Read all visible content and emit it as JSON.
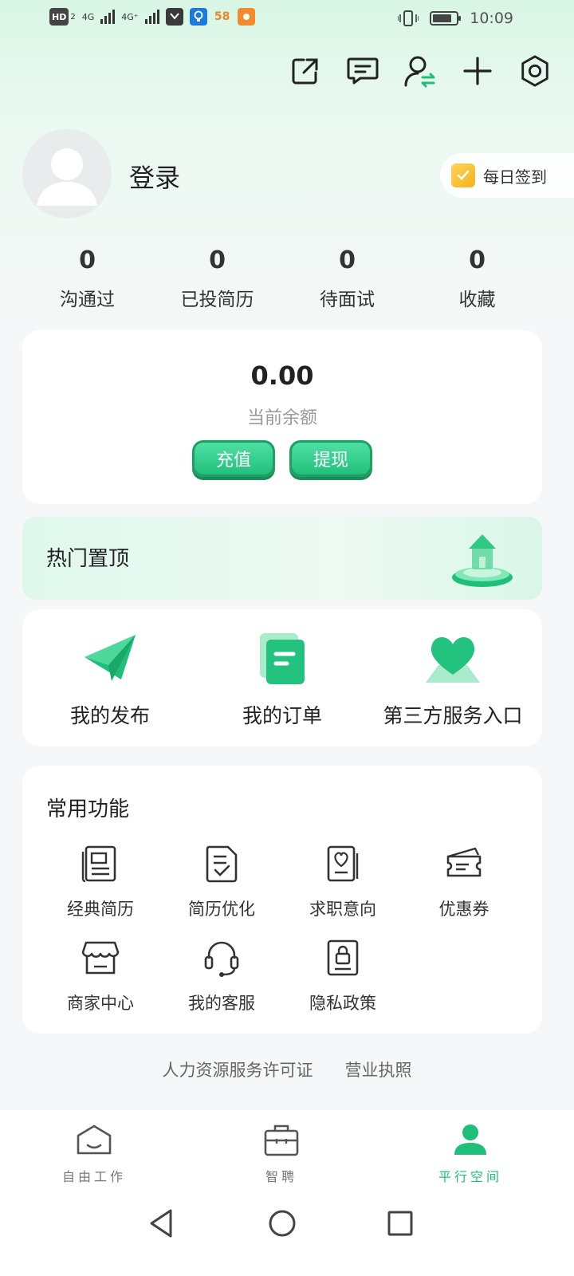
{
  "status_bar": {
    "network_hd": "HD",
    "network_hd_sub": "2",
    "signal_1": "4G",
    "signal_2": "4G⁺",
    "app_58": "58",
    "time": "10:09",
    "battery_level": 0.8
  },
  "profile": {
    "login_label": "登录",
    "checkin_label": "每日签到"
  },
  "stats": [
    {
      "value": "0",
      "label": "沟通过"
    },
    {
      "value": "0",
      "label": "已投简历"
    },
    {
      "value": "0",
      "label": "待面试"
    },
    {
      "value": "0",
      "label": "收藏"
    }
  ],
  "balance": {
    "amount": "0.00",
    "label": "当前余额",
    "recharge_label": "充值",
    "withdraw_label": "提现"
  },
  "hot": {
    "title": "热门置顶"
  },
  "quick": [
    {
      "label": "我的发布",
      "icon": "paper-plane-icon"
    },
    {
      "label": "我的订单",
      "icon": "order-document-icon"
    },
    {
      "label": "第三方服务入口",
      "icon": "heart-icon"
    }
  ],
  "functions": {
    "title": "常用功能",
    "items": [
      {
        "label": "经典简历",
        "icon": "resume-icon"
      },
      {
        "label": "简历优化",
        "icon": "resume-check-icon"
      },
      {
        "label": "求职意向",
        "icon": "job-intent-icon"
      },
      {
        "label": "优惠券",
        "icon": "coupon-icon"
      },
      {
        "label": "商家中心",
        "icon": "store-icon"
      },
      {
        "label": "我的客服",
        "icon": "headset-icon"
      },
      {
        "label": "隐私政策",
        "icon": "privacy-lock-icon"
      }
    ]
  },
  "footer": {
    "license_label": "人力资源服务许可证",
    "business_label": "营业执照"
  },
  "tabs": [
    {
      "label": "自由工作",
      "icon": "home-icon"
    },
    {
      "label": "智聘",
      "icon": "briefcase-icon"
    },
    {
      "label": "平行空间",
      "icon": "person-icon",
      "active": true
    }
  ],
  "colors": {
    "accent": "#1fbf79",
    "accent_light": "#dff8ec",
    "background": "#f6f7f8"
  }
}
